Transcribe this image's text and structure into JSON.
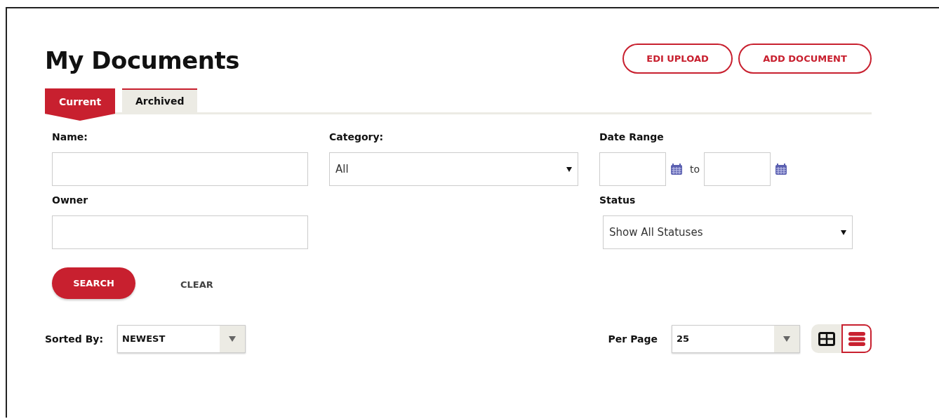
{
  "title": "My Documents",
  "actions": [
    "EDI UPLOAD",
    "ADD DOCUMENT"
  ],
  "tabs": [
    {
      "label": "Current",
      "selected": true
    },
    {
      "label": "Archived",
      "selected": false
    }
  ],
  "filters": {
    "name": {
      "label": "Name:"
    },
    "category": {
      "label": "Category:",
      "value": "All"
    },
    "date_range": {
      "label": "Date Range",
      "separator": "to"
    },
    "owner": {
      "label": "Owner"
    },
    "status": {
      "label": "Status",
      "value": "Show All Statuses"
    }
  },
  "search_button": "SEARCH",
  "clear_button": "CLEAR",
  "sort": {
    "label": "Sorted By:",
    "value": "NEWEST"
  },
  "per_page": {
    "label": "Per Page",
    "value": "25"
  },
  "views": [
    {
      "kind": "grid",
      "selected": false
    },
    {
      "kind": "list",
      "selected": true
    }
  ]
}
